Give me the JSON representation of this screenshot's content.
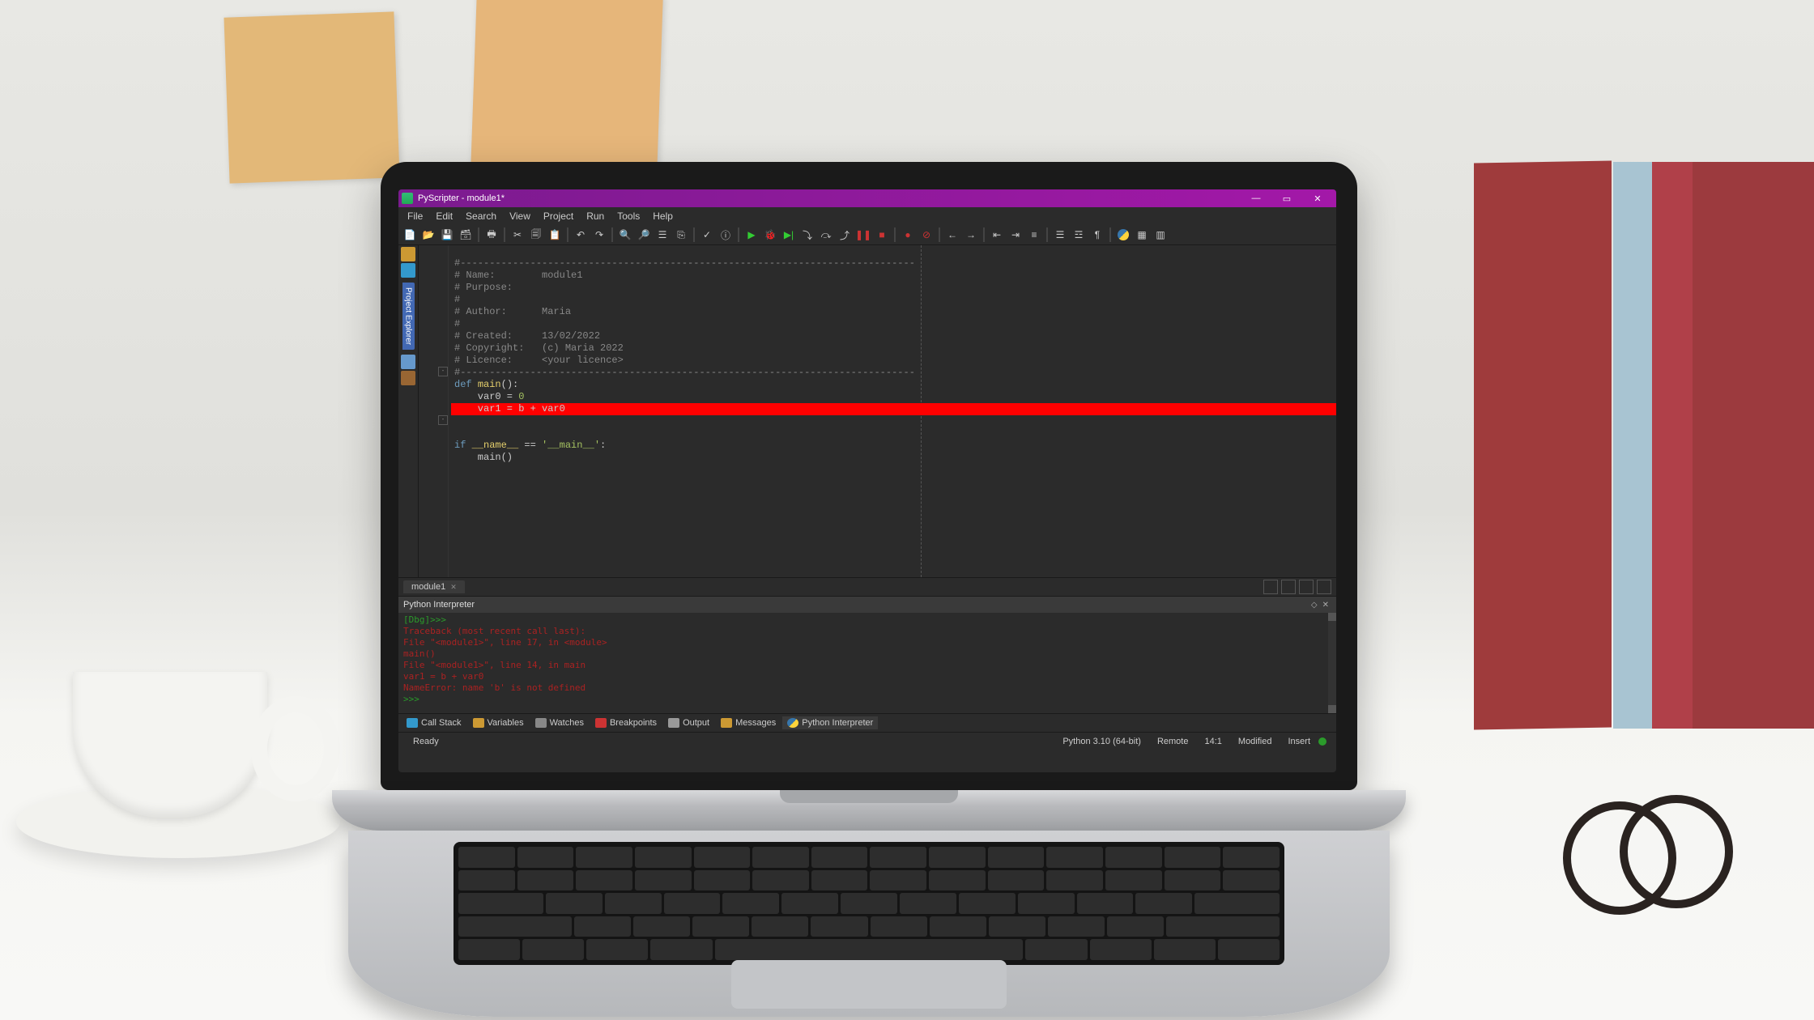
{
  "titlebar": {
    "title": "PyScripter - module1*"
  },
  "menus": [
    "File",
    "Edit",
    "Search",
    "View",
    "Project",
    "Run",
    "Tools",
    "Help"
  ],
  "sidebar": {
    "tab_label": "Project Explorer"
  },
  "editor": {
    "lines": {
      "dash": "#------------------------------------------------------------------------------",
      "name": "# Name:        module1",
      "purpose": "# Purpose:",
      "hash": "#",
      "author": "# Author:      Maria",
      "created": "# Created:     13/02/2022",
      "copyright": "# Copyright:   (c) Maria 2022",
      "licence": "# Licence:     <your licence>",
      "def": "def main():",
      "var0": "    var0 = 0",
      "err": "    var1 = b + var0",
      "ifmain": "if __name__ == '__main__':",
      "callmain": "    main()"
    }
  },
  "tabbar": {
    "file": "module1"
  },
  "interpreter": {
    "title": "Python Interpreter",
    "console": {
      "prompt": "[Dbg]>>>",
      "l1": "Traceback (most recent call last):",
      "l2": "  File \"<module1>\", line 17, in <module>",
      "l3": "    main()",
      "l4": "  File \"<module1>\", line 14, in main",
      "l5": "    var1 = b + var0",
      "l6": "NameError: name 'b' is not defined",
      "l7": ">>>"
    }
  },
  "bottom_tabs": {
    "callstack": "Call Stack",
    "variables": "Variables",
    "watches": "Watches",
    "breakpoints": "Breakpoints",
    "output": "Output",
    "messages": "Messages",
    "python": "Python Interpreter"
  },
  "status": {
    "ready": "Ready",
    "python": "Python 3.10 (64-bit)",
    "engine": "Remote",
    "pos": "14:1",
    "modified": "Modified",
    "insert": "Insert"
  }
}
